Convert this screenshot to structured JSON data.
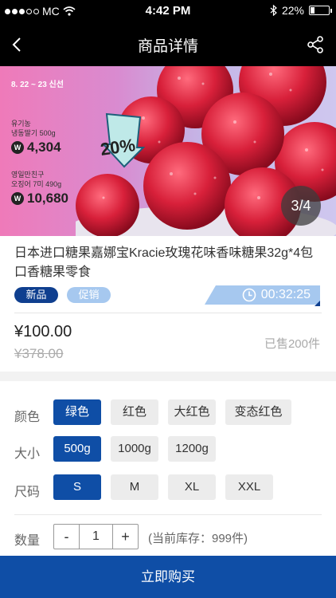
{
  "status_bar": {
    "carrier": "MC",
    "time": "4:42 PM",
    "battery": "22%",
    "battery_level": 0.22,
    "icons": [
      "signal-dots-icon",
      "wifi-icon",
      "bluetooth-icon",
      "battery-icon"
    ]
  },
  "navbar": {
    "title": "商品详情",
    "back_icon": "chevron-left-icon",
    "share_icon": "share-icon"
  },
  "banner": {
    "date_text": "8. 22 ~ 23  신선",
    "promo1_name_line1": "유기농",
    "promo1_name_line2": "냉동딸기 500g",
    "promo1_price": "4,304",
    "promo2_name_line1": "영일만친구",
    "promo2_name_line2": "오징어 7미 490g",
    "promo2_price": "10,680",
    "discount": "20%",
    "won_symbol": "W",
    "pager": "3/4"
  },
  "product": {
    "title": "日本进口糖果嘉娜宝Kracie玫瑰花味香味糖果32g*4包口香糖果零食",
    "tag_new": "新品",
    "tag_promo": "促销",
    "countdown": "00:32:25",
    "price": "¥100.00",
    "original_price": "¥378.00",
    "sold": "已售200件"
  },
  "options": {
    "color_label": "颜色",
    "colors": [
      "绿色",
      "红色",
      "大红色",
      "变态红色"
    ],
    "color_selected": "绿色",
    "size_label": "大小",
    "sizes": [
      "500g",
      "1000g",
      "1200g"
    ],
    "size_selected": "500g",
    "dimension_label": "尺码",
    "dimensions": [
      "S",
      "M",
      "XL",
      "XXL"
    ],
    "dimension_selected": "S"
  },
  "quantity": {
    "label": "数量",
    "minus": "-",
    "value": "1",
    "plus": "+",
    "stock": "(当前库存：999件)"
  },
  "buy_button": "立即购买",
  "colors": {
    "primary": "#0f4ea6",
    "tag_new": "#0f3f8f",
    "tag_promo": "#a6c8ef"
  }
}
